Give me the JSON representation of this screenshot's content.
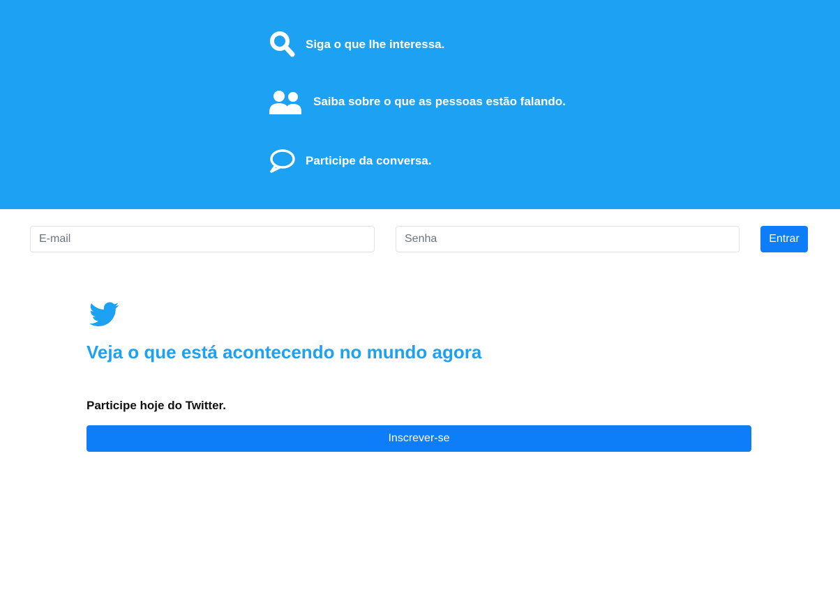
{
  "hero": {
    "background_color": "#1da1f2",
    "features": [
      {
        "icon": "search-icon",
        "text": "Siga o que lhe interessa."
      },
      {
        "icon": "users-icon",
        "text": "Saiba sobre o que as pessoas estão falando."
      },
      {
        "icon": "comment-icon",
        "text": "Participe da conversa."
      }
    ]
  },
  "login": {
    "email_placeholder": "E-mail",
    "email_value": "",
    "password_placeholder": "Senha",
    "password_value": "",
    "submit_label": "Entrar"
  },
  "main": {
    "logo_icon": "twitter-bird-icon",
    "headline": "Veja o que está acontecendo no mundo agora",
    "subheading": "Participe hoje do Twitter.",
    "signup_label": "Inscrever-se"
  },
  "colors": {
    "brand": "#1da1f2",
    "button": "#0d7ef8"
  }
}
